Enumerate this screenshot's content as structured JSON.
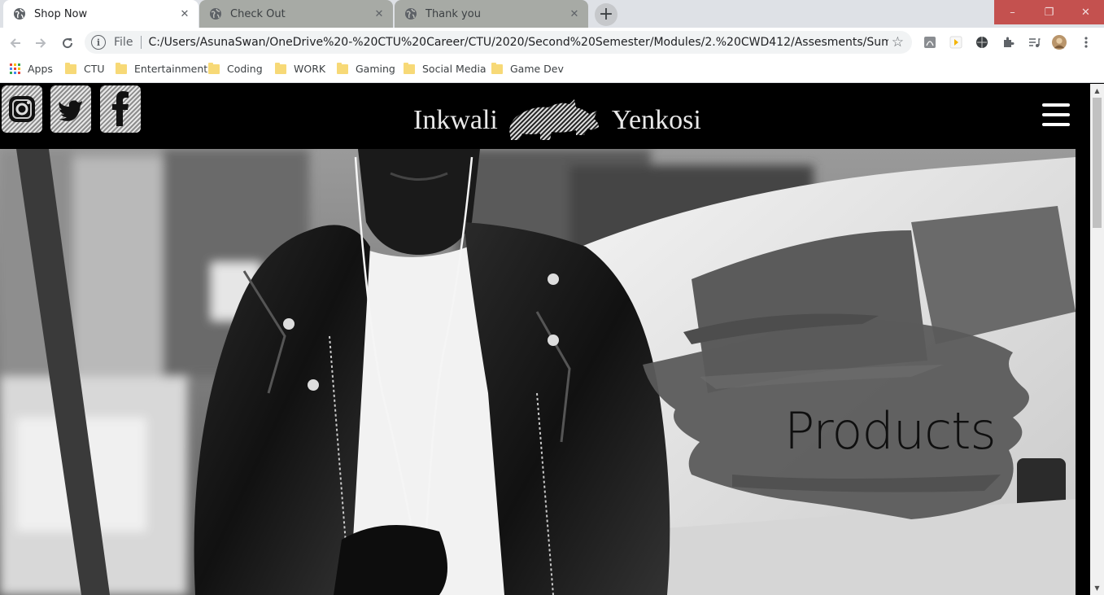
{
  "browser": {
    "tabs": [
      {
        "title": "Shop Now",
        "active": true
      },
      {
        "title": "Check Out",
        "active": false
      },
      {
        "title": "Thank you",
        "active": false
      }
    ],
    "new_tab_label": "+",
    "window_buttons": {
      "minimize": "–",
      "restore": "❐",
      "close": "✕"
    },
    "address": {
      "scheme_label": "File",
      "url": "C:/Users/AsunaSwan/OneDrive%20-%20CTU%20Career/CTU/2020/Second%20Semester/Modules/2.%20CWD412/Assesments/Summitives/Code..."
    },
    "bookmarks": [
      {
        "label": "Apps",
        "icon": "apps-grid-icon"
      },
      {
        "label": "CTU",
        "icon": "folder-icon"
      },
      {
        "label": "Entertainment",
        "icon": "folder-icon"
      },
      {
        "label": "Coding",
        "icon": "folder-icon"
      },
      {
        "label": "WORK",
        "icon": "folder-icon"
      },
      {
        "label": "Gaming",
        "icon": "folder-icon"
      },
      {
        "label": "Social Media",
        "icon": "folder-icon"
      },
      {
        "label": "Game Dev",
        "icon": "folder-icon"
      }
    ],
    "colors": {
      "tabstrip": "#dee1e6",
      "window_controls": "#c4514f",
      "folder": "#f7d977"
    }
  },
  "site": {
    "social_icons": [
      "instagram-icon",
      "twitter-icon",
      "facebook-icon"
    ],
    "logo": {
      "left_word": "Inkwali",
      "right_word": "Yenkosi"
    },
    "menu_icon": "hamburger-menu-icon",
    "hero": {
      "title": "Products"
    }
  }
}
